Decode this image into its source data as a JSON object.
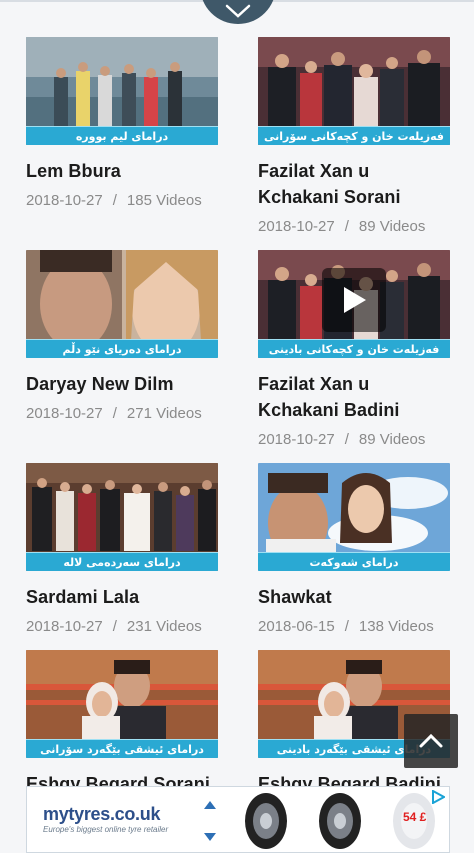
{
  "videos": [
    {
      "title": "Lem Bbura",
      "banner": "درامای لیم بوورە",
      "date": "2018-10-27",
      "count": "185 Videos"
    },
    {
      "title": "Fazilat Xan u Kchakani Sorani",
      "banner": "فەزیلەت خان و کچەکانی سۆرانی",
      "date": "2018-10-27",
      "count": "89 Videos"
    },
    {
      "title": "Daryay New Dilm",
      "banner": "درامای دەریای نێو دڵم",
      "date": "2018-10-27",
      "count": "271 Videos"
    },
    {
      "title": "Fazilat Xan u Kchakani Badini",
      "banner": "فەزیلەت خان و کچەکانی بادینی",
      "date": "2018-10-27",
      "count": "89 Videos"
    },
    {
      "title": "Sardami Lala",
      "banner": "درامای سەردەمی لالە",
      "date": "2018-10-27",
      "count": "231 Videos"
    },
    {
      "title": "Shawkat",
      "banner": "درامای شەوکەت",
      "date": "2018-06-15",
      "count": "138 Videos"
    },
    {
      "title": "Eshqy Begard Sorani",
      "banner": "درامای ئیشقی بێگەرد سۆرانی",
      "date": "",
      "count": ""
    },
    {
      "title": "Eshqy Begard Badini",
      "banner": "درامای ئیشقی بێگەرد بادینی",
      "date": "",
      "count": ""
    }
  ],
  "separator": "/",
  "ad": {
    "brand": "mytyres.co.uk",
    "tagline": "Europe's biggest online tyre retailer",
    "price": "54 £"
  },
  "icons": {
    "collapse": "chevron-down-icon",
    "play": "play-icon",
    "scroll_top": "chevron-up-icon",
    "ad_info": "ad-choices-icon"
  },
  "colors": {
    "banner": "#2aa9d3",
    "pull_tab": "#3f5869",
    "brand": "#2d4f8a",
    "price": "#e02020"
  }
}
